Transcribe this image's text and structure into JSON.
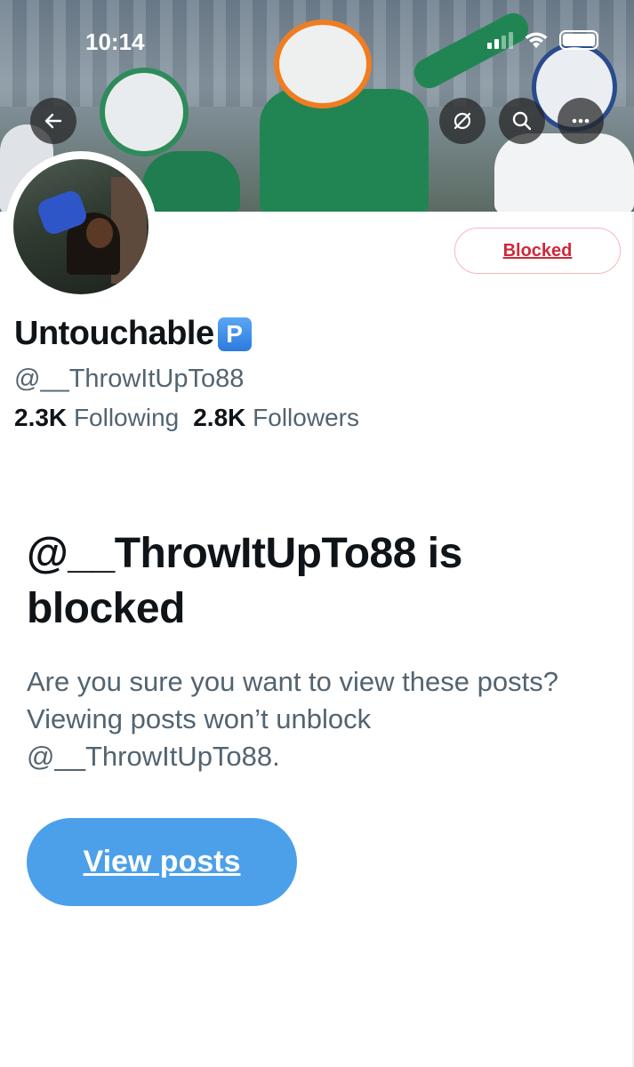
{
  "status_bar": {
    "time": "10:14"
  },
  "header": {
    "icons": [
      "back-arrow-icon",
      "translate-icon",
      "search-icon",
      "more-icon"
    ]
  },
  "profile": {
    "display_name": "Untouchable",
    "badge": "P",
    "handle": "@__ThrowItUpTo88",
    "following_count": "2.3K",
    "following_label": "Following",
    "followers_count": "2.8K",
    "followers_label": "Followers",
    "blocked_button_label": "Blocked"
  },
  "blocked_notice": {
    "title": "@__ThrowItUpTo88 is blocked",
    "description": "Are you sure you want to view these posts? Viewing posts won’t unblock @__ThrowItUpTo88.",
    "view_posts_label": "View posts"
  },
  "colors": {
    "accent": "#4ca0ea",
    "blocked_red": "#d0283a",
    "secondary_text": "#536471",
    "primary_text": "#0f1419"
  }
}
